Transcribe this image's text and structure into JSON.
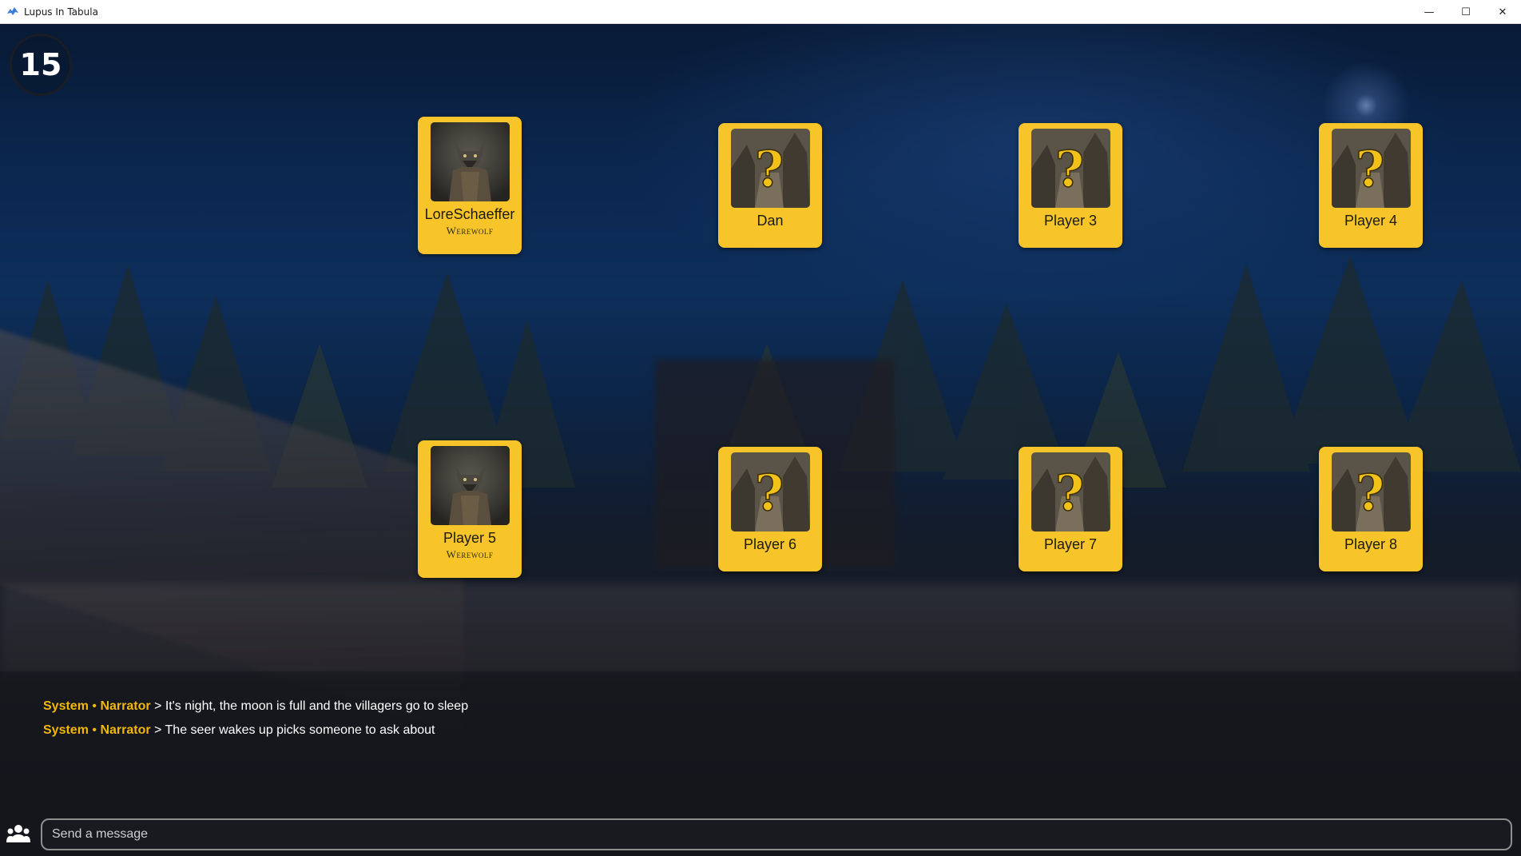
{
  "window": {
    "title": "Lupus In Tabula",
    "controls": {
      "minimize": "—",
      "maximize": "☐",
      "close": "✕"
    }
  },
  "game": {
    "counter": "15",
    "players": [
      {
        "name": "LoreSchaeffer",
        "role": "Werewolf",
        "revealed": true,
        "portrait_icon": "werewolf-portrait"
      },
      {
        "name": "Dan",
        "role": "",
        "revealed": false,
        "portrait_icon": "mystery-portrait"
      },
      {
        "name": "Player 3",
        "role": "",
        "revealed": false,
        "portrait_icon": "mystery-portrait"
      },
      {
        "name": "Player 4",
        "role": "",
        "revealed": false,
        "portrait_icon": "mystery-portrait"
      },
      {
        "name": "Player 5",
        "role": "Werewolf",
        "revealed": true,
        "portrait_icon": "werewolf-portrait"
      },
      {
        "name": "Player 6",
        "role": "",
        "revealed": false,
        "portrait_icon": "mystery-portrait"
      },
      {
        "name": "Player 7",
        "role": "",
        "revealed": false,
        "portrait_icon": "mystery-portrait"
      },
      {
        "name": "Player 8",
        "role": "",
        "revealed": false,
        "portrait_icon": "mystery-portrait"
      }
    ]
  },
  "chat": {
    "messages": [
      {
        "sender": "System",
        "separator": "•",
        "channel": "Narrator",
        "arrow": ">",
        "text": "It's night, the moon is full and the villagers go to sleep"
      },
      {
        "sender": "System",
        "separator": "•",
        "channel": "Narrator",
        "arrow": ">",
        "text": "The seer wakes up picks someone to ask about"
      }
    ],
    "input_placeholder": "Send a message",
    "input_value": ""
  },
  "colors": {
    "card": "#f7c52a",
    "accent": "#f2b705"
  }
}
